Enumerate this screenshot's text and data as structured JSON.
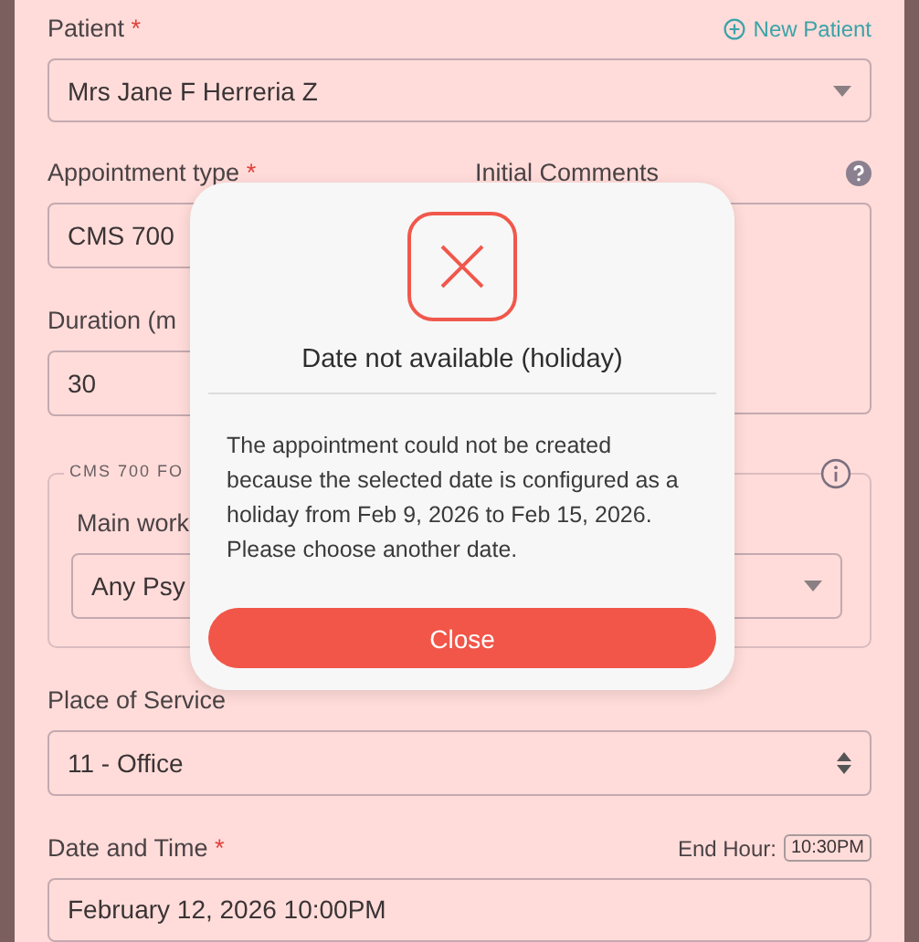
{
  "form": {
    "patient": {
      "label": "Patient",
      "required_mark": "*",
      "action": "New Patient",
      "value": "Mrs Jane F Herreria Z"
    },
    "appointment_type": {
      "label": "Appointment type",
      "required_mark": "*",
      "value": "CMS 700"
    },
    "initial_comments": {
      "label": "Initial Comments"
    },
    "duration": {
      "label": "Duration (m",
      "value": "30"
    },
    "fieldset": {
      "legend": "CMS 700 FO",
      "field_label": "Main work",
      "value": "Any Psy"
    },
    "place_of_service": {
      "label": "Place of Service",
      "value": "11 - Office"
    },
    "date_time": {
      "label": "Date and Time",
      "required_mark": "*",
      "end_hour_label": "End Hour:",
      "end_hour": "10:30PM",
      "value": "February 12, 2026 10:00PM"
    }
  },
  "dialog": {
    "title": "Date not available (holiday)",
    "message": "The appointment could not be created because the selected date is configured as a holiday from Feb 9, 2026 to Feb 15, 2026. Please choose another date.",
    "button": "Close"
  }
}
